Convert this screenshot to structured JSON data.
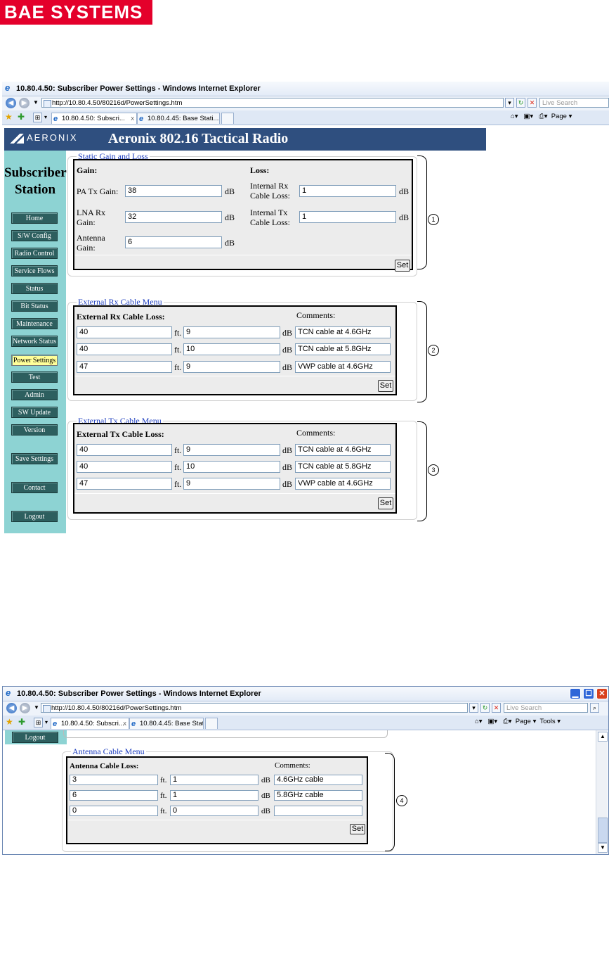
{
  "logo": {
    "text": "BAE SYSTEMS"
  },
  "window1": {
    "title": "10.80.4.50: Subscriber Power Settings - Windows Internet Explorer",
    "url": "http://10.80.4.50/80216d/PowerSettings.htm",
    "search_placeholder": "Live Search",
    "tabs": [
      {
        "label": "10.80.4.50: Subscri...",
        "close": "x"
      },
      {
        "label": "10.80.4.45: Base Stati..."
      }
    ],
    "page_menu": "Page"
  },
  "app": {
    "brand": "AERONIX",
    "title": "Aeronix 802.16 Tactical Radio",
    "sidebar_title_line1": "Subscriber",
    "sidebar_title_line2": "Station",
    "nav": [
      "Home",
      "S/W Config",
      "Radio Control",
      "Service Flows",
      "Status",
      "Bit Status",
      "Maintenance",
      "Network Status",
      "Power Settings",
      "Test",
      "Admin",
      "SW Update",
      "Version"
    ],
    "save_settings": "Save Settings",
    "contact": "Contact",
    "logout": "Logout"
  },
  "static": {
    "legend": "Static Gain and Loss",
    "gain_header": "Gain:",
    "loss_header": "Loss:",
    "pa_tx_label": "PA Tx Gain:",
    "pa_tx_value": "38",
    "lna_rx_label_1": "LNA Rx",
    "lna_rx_label_2": "Gain:",
    "lna_rx_value": "32",
    "antenna_label_1": "Antenna",
    "antenna_label_2": "Gain:",
    "antenna_value": "6",
    "int_rx_label_1": "Internal Rx",
    "int_rx_label_2": "Cable Loss:",
    "int_rx_value": "1",
    "int_tx_label_1": "Internal Tx",
    "int_tx_label_2": "Cable Loss:",
    "int_tx_value": "1",
    "unit_db": "dB",
    "set": "Set"
  },
  "ext_rx": {
    "legend": "External Rx Cable Menu",
    "header": "External Rx Cable Loss:",
    "comments_header": "Comments:",
    "rows": [
      {
        "length": "40",
        "loss": "9",
        "comment": "TCN cable at 4.6GHz"
      },
      {
        "length": "40",
        "loss": "10",
        "comment": "TCN cable at 5.8GHz"
      },
      {
        "length": "47",
        "loss": "9",
        "comment": "VWP cable at 4.6GHz"
      }
    ],
    "unit_ft": "ft.",
    "unit_db": "dB",
    "set": "Set"
  },
  "ext_tx": {
    "legend": "External Tx Cable Menu",
    "header": "External Tx Cable Loss:",
    "comments_header": "Comments:",
    "rows": [
      {
        "length": "40",
        "loss": "9",
        "comment": "TCN cable at 4.6GHz"
      },
      {
        "length": "40",
        "loss": "10",
        "comment": "TCN cable at 5.8GHz"
      },
      {
        "length": "47",
        "loss": "9",
        "comment": "VWP cable at 4.6GHz"
      }
    ],
    "unit_ft": "ft.",
    "unit_db": "dB",
    "set": "Set"
  },
  "callouts": [
    "1",
    "2",
    "3",
    "4"
  ],
  "window2": {
    "title": "10.80.4.50: Subscriber Power Settings - Windows Internet Explorer",
    "url": "http://10.80.4.50/80216d/PowerSettings.htm",
    "search_placeholder": "Live Search",
    "tabs": [
      {
        "label": "10.80.4.50: Subscri...",
        "close": "x"
      },
      {
        "label": "10.80.4.45: Base Stati..."
      }
    ],
    "page_menu": "Page",
    "tools_menu": "Tools",
    "logout": "Logout"
  },
  "antenna": {
    "legend": "Antenna Cable Menu",
    "header": "Antenna Cable Loss:",
    "comments_header": "Comments:",
    "rows": [
      {
        "length": "3",
        "loss": "1",
        "comment": "4.6GHz cable"
      },
      {
        "length": "6",
        "loss": "1",
        "comment": "5.8GHz cable"
      },
      {
        "length": "0",
        "loss": "0",
        "comment": ""
      }
    ],
    "unit_ft": "ft.",
    "unit_db": "dB",
    "set": "Set"
  }
}
